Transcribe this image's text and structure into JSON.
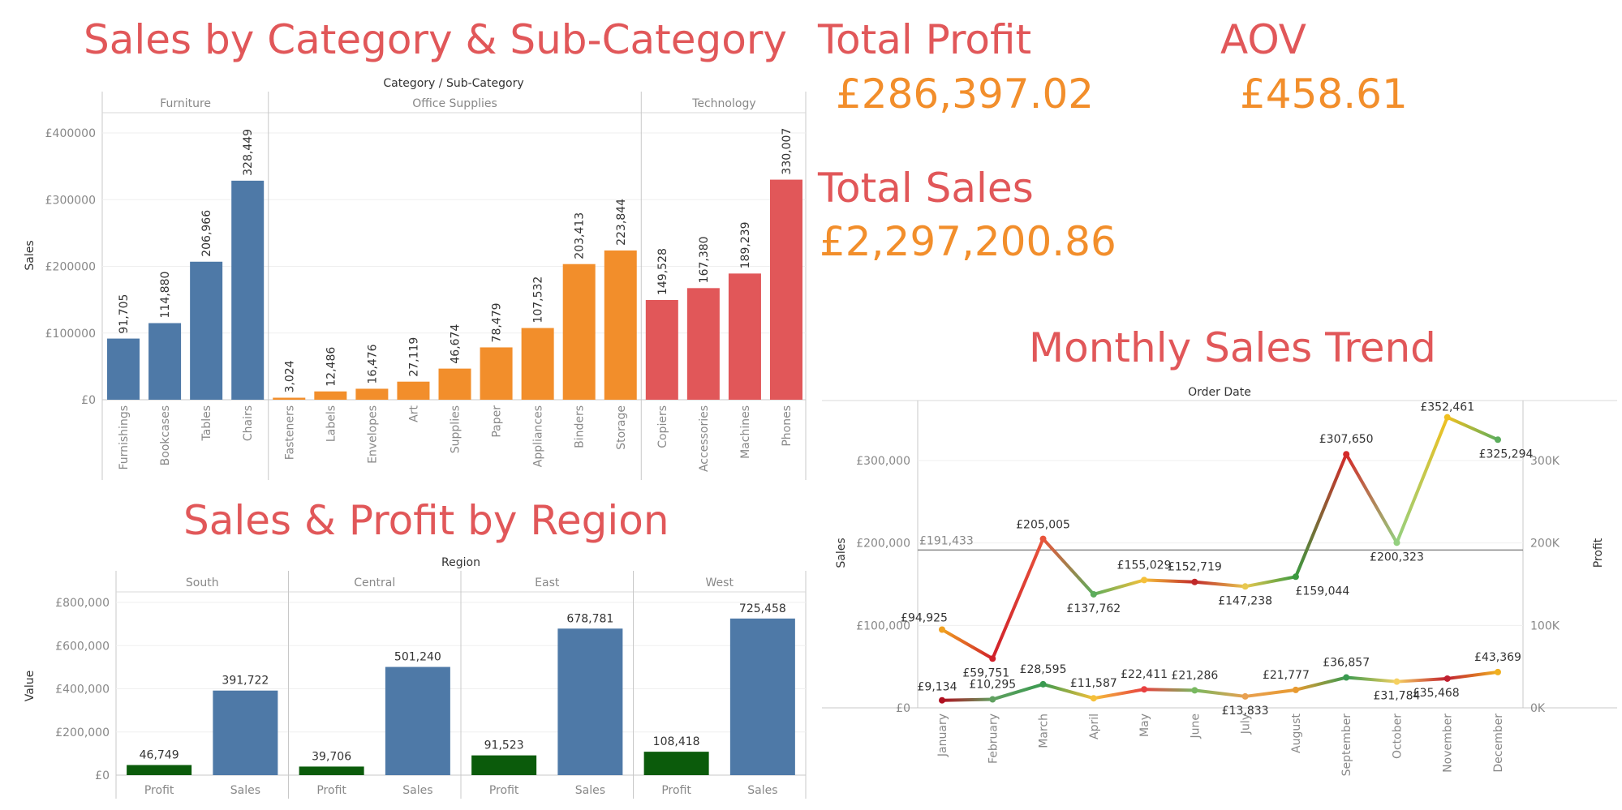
{
  "titles": {
    "category": "Sales by Category & Sub-Category",
    "region": "Sales & Profit by Region",
    "monthly": "Monthly Sales Trend"
  },
  "kpis": {
    "total_profit_label": "Total Profit",
    "total_profit_value": "£286,397.02",
    "aov_label": "AOV",
    "aov_value": "£458.61",
    "total_sales_label": "Total Sales",
    "total_sales_value": "£2,297,200.86"
  },
  "chart_data": [
    {
      "id": "category",
      "type": "bar",
      "header": "Category / Sub-Category",
      "ylabel": "Sales",
      "ylim": [
        0,
        400000
      ],
      "yticks": [
        "£0",
        "£100000",
        "£200000",
        "£300000",
        "£400000"
      ],
      "groups": [
        {
          "name": "Furniture",
          "color": "#4e79a7",
          "categories": [
            "Furnishings",
            "Bookcases",
            "Tables",
            "Chairs"
          ],
          "values": [
            91705,
            114880,
            206966,
            328449
          ],
          "labels": [
            "91,705",
            "114,880",
            "206,966",
            "328,449"
          ]
        },
        {
          "name": "Office Supplies",
          "color": "#f28e2b",
          "categories": [
            "Fasteners",
            "Labels",
            "Envelopes",
            "Art",
            "Supplies",
            "Paper",
            "Appliances",
            "Binders",
            "Storage"
          ],
          "values": [
            3024,
            12486,
            16476,
            27119,
            46674,
            78479,
            107532,
            203413,
            223844
          ],
          "labels": [
            "3,024",
            "12,486",
            "16,476",
            "27,119",
            "46,674",
            "78,479",
            "107,532",
            "203,413",
            "223,844"
          ]
        },
        {
          "name": "Technology",
          "color": "#e15759",
          "categories": [
            "Copiers",
            "Accessories",
            "Machines",
            "Phones"
          ],
          "values": [
            149528,
            167380,
            189239,
            330007
          ],
          "labels": [
            "149,528",
            "167,380",
            "189,239",
            "330,007"
          ]
        }
      ]
    },
    {
      "id": "region",
      "type": "bar",
      "header": "Region",
      "ylabel": "Value",
      "ylim": [
        0,
        900000
      ],
      "yticks": [
        "£0",
        "£200,000",
        "£400,000",
        "£600,000",
        "£800,000"
      ],
      "regions": [
        "South",
        "Central",
        "East",
        "West"
      ],
      "measures": [
        "Profit",
        "Sales"
      ],
      "series": [
        {
          "name": "Profit",
          "color": "#0b5b0b",
          "values": [
            46749,
            39706,
            91523,
            108418
          ],
          "labels": [
            "46,749",
            "39,706",
            "91,523",
            "108,418"
          ]
        },
        {
          "name": "Sales",
          "color": "#4e79a7",
          "values": [
            391722,
            501240,
            678781,
            725458
          ],
          "labels": [
            "391,722",
            "501,240",
            "678,781",
            "725,458"
          ]
        }
      ]
    },
    {
      "id": "monthly",
      "type": "line",
      "header": "Order Date",
      "ylabel": "Sales",
      "y2label": "Profit",
      "ylim": [
        0,
        370000
      ],
      "y2lim": [
        0,
        370000
      ],
      "yticks": [
        "£0",
        "£100,000",
        "£200,000",
        "£300,000"
      ],
      "y2ticks": [
        "0K",
        "100K",
        "200K",
        "300K"
      ],
      "x": [
        "January",
        "February",
        "March",
        "April",
        "May",
        "June",
        "July",
        "August",
        "September",
        "October",
        "November",
        "December"
      ],
      "reference_line": {
        "value": 191433,
        "label": "£191,433"
      },
      "series": [
        {
          "name": "Sales",
          "values": [
            94925,
            59751,
            205005,
            137762,
            155029,
            152719,
            147238,
            159044,
            307650,
            200323,
            352461,
            325294
          ],
          "labels": [
            "£94,925",
            "£59,751",
            "£205,005",
            "£137,762",
            "£155,029",
            "£152,719",
            "£147,238",
            "£159,044",
            "£307,650",
            "£200,323",
            "£352,461",
            "£325,294"
          ],
          "colors": [
            "#f0a020",
            "#d0202a",
            "#e8543b",
            "#5cad5c",
            "#f5c03a",
            "#c0282a",
            "#e8c850",
            "#3a9a40",
            "#d42a2a",
            "#94d080",
            "#f0c020",
            "#5cad5c"
          ]
        },
        {
          "name": "Profit",
          "values": [
            9134,
            10295,
            28595,
            11587,
            22411,
            21286,
            13833,
            21777,
            36857,
            31784,
            35468,
            43369
          ],
          "labels": [
            "£9,134",
            "£10,295",
            "£28,595",
            "£11,587",
            "£22,411",
            "£21,286",
            "£13,833",
            "£21,777",
            "£36,857",
            "£31,784",
            "£35,468",
            "£43,369"
          ],
          "colors": [
            "#b01020",
            "#60a060",
            "#3a9a50",
            "#f5c03a",
            "#e84040",
            "#78b860",
            "#e8a050",
            "#e89a30",
            "#3a9a50",
            "#f5d060",
            "#c02030",
            "#f0b020"
          ]
        }
      ]
    }
  ]
}
